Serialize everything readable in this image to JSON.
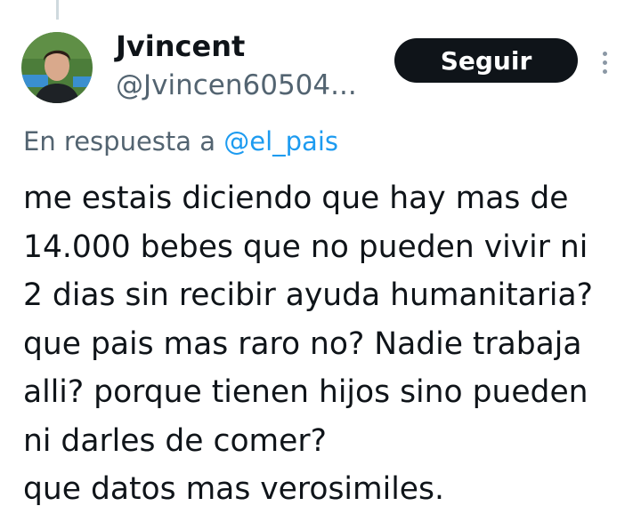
{
  "tweet": {
    "author": {
      "display_name": "Jvincent",
      "handle": "@Jvincen60504..."
    },
    "follow_label": "Seguir",
    "more_icon": "more-vertical-icon",
    "reply_context": {
      "prefix": "En respuesta a ",
      "mention": "@el_pais"
    },
    "text": "me estais diciendo que hay mas de\n14.000 bebes que no pueden vivir ni\n2 dias sin recibir ayuda humanitaria?\nque pais mas raro no? Nadie trabaja\nalli? porque tienen hijos sino pueden\nni darles de comer?\nque datos mas verosimiles."
  },
  "colors": {
    "primary_text": "#0f1419",
    "secondary_text": "#536471",
    "link": "#1d9bf0",
    "button_bg": "#0f1419",
    "button_text": "#ffffff",
    "thread_line": "#cfd9de"
  }
}
